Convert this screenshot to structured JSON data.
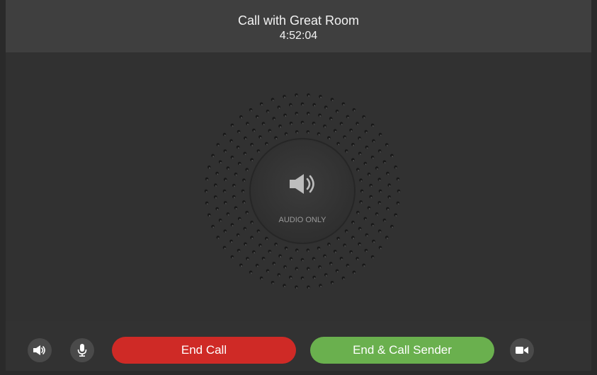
{
  "header": {
    "title": "Call with Great Room",
    "timer": "4:52:04"
  },
  "center": {
    "mode_label": "AUDIO ONLY",
    "mode_icon": "speaker-icon"
  },
  "toolbar": {
    "volume_icon": "speaker-icon",
    "mic_icon": "microphone-icon",
    "end_call_label": "End Call",
    "end_call_sender_label": "End & Call Sender",
    "video_icon": "video-camera-icon"
  },
  "colors": {
    "end_call": "#cf2a26",
    "end_call_sender": "#6ab04e",
    "background": "#323232",
    "header": "#3f3f3f"
  }
}
